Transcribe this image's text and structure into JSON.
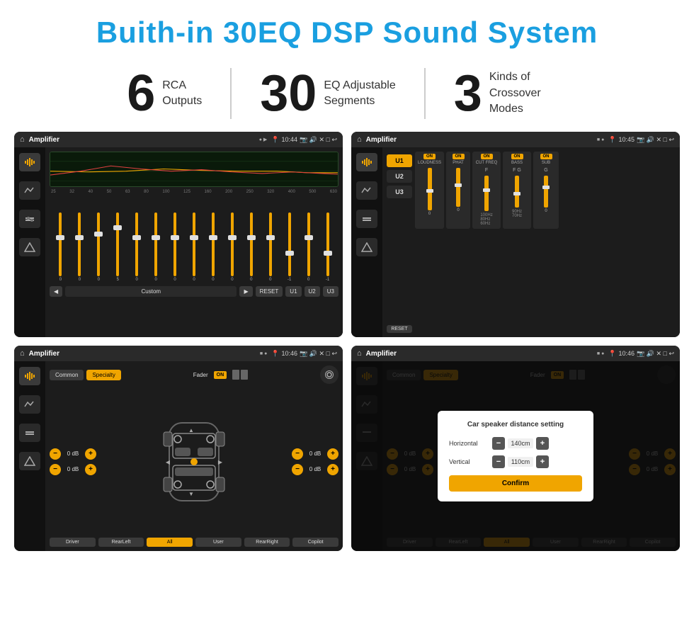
{
  "header": {
    "title": "Buith-in 30EQ DSP Sound System"
  },
  "stats": [
    {
      "number": "6",
      "label": "RCA\nOutputs"
    },
    {
      "number": "30",
      "label": "EQ Adjustable\nSegments"
    },
    {
      "number": "3",
      "label": "Kinds of\nCrossover Modes"
    }
  ],
  "screens": [
    {
      "id": "eq-screen",
      "status_bar": {
        "app": "Amplifier",
        "time": "10:44"
      }
    },
    {
      "id": "crossover-screen",
      "status_bar": {
        "app": "Amplifier",
        "time": "10:45"
      }
    },
    {
      "id": "fader-screen",
      "status_bar": {
        "app": "Amplifier",
        "time": "10:46"
      }
    },
    {
      "id": "dialog-screen",
      "status_bar": {
        "app": "Amplifier",
        "time": "10:46"
      },
      "dialog": {
        "title": "Car speaker distance setting",
        "horizontal_label": "Horizontal",
        "horizontal_value": "140cm",
        "vertical_label": "Vertical",
        "vertical_value": "110cm",
        "confirm_label": "Confirm"
      }
    }
  ],
  "eq": {
    "frequencies": [
      "25",
      "32",
      "40",
      "50",
      "63",
      "80",
      "100",
      "125",
      "160",
      "200",
      "250",
      "320",
      "400",
      "500",
      "630"
    ],
    "values": [
      "0",
      "0",
      "0",
      "5",
      "0",
      "0",
      "0",
      "0",
      "0",
      "0",
      "0",
      "0",
      "-1",
      "0",
      "-1"
    ],
    "presets": [
      "Custom",
      "RESET",
      "U1",
      "U2",
      "U3"
    ]
  },
  "crossover": {
    "presets": [
      "U1",
      "U2",
      "U3"
    ],
    "channels": [
      "LOUDNESS",
      "PHAT",
      "CUT FREQ",
      "BASS",
      "SUB"
    ],
    "reset": "RESET"
  },
  "fader": {
    "modes": [
      "Common",
      "Specialty"
    ],
    "label": "Fader",
    "on_label": "ON",
    "zones": [
      "Driver",
      "RearLeft",
      "All",
      "User",
      "RearRight",
      "Copilot"
    ],
    "db_values": [
      "0 dB",
      "0 dB",
      "0 dB",
      "0 dB"
    ]
  },
  "dialog_screen": {
    "fader_modes": [
      "Common",
      "Specialty"
    ],
    "label": "Fader",
    "on_label": "ON",
    "dialog": {
      "title": "Car speaker distance setting",
      "horizontal_label": "Horizontal",
      "horizontal_value": "140cm",
      "vertical_label": "Vertical",
      "vertical_value": "110cm",
      "confirm_label": "Confirm"
    },
    "zones": [
      "Driver",
      "RearLeft",
      "All",
      "User",
      "RearRight",
      "Copilot"
    ]
  }
}
